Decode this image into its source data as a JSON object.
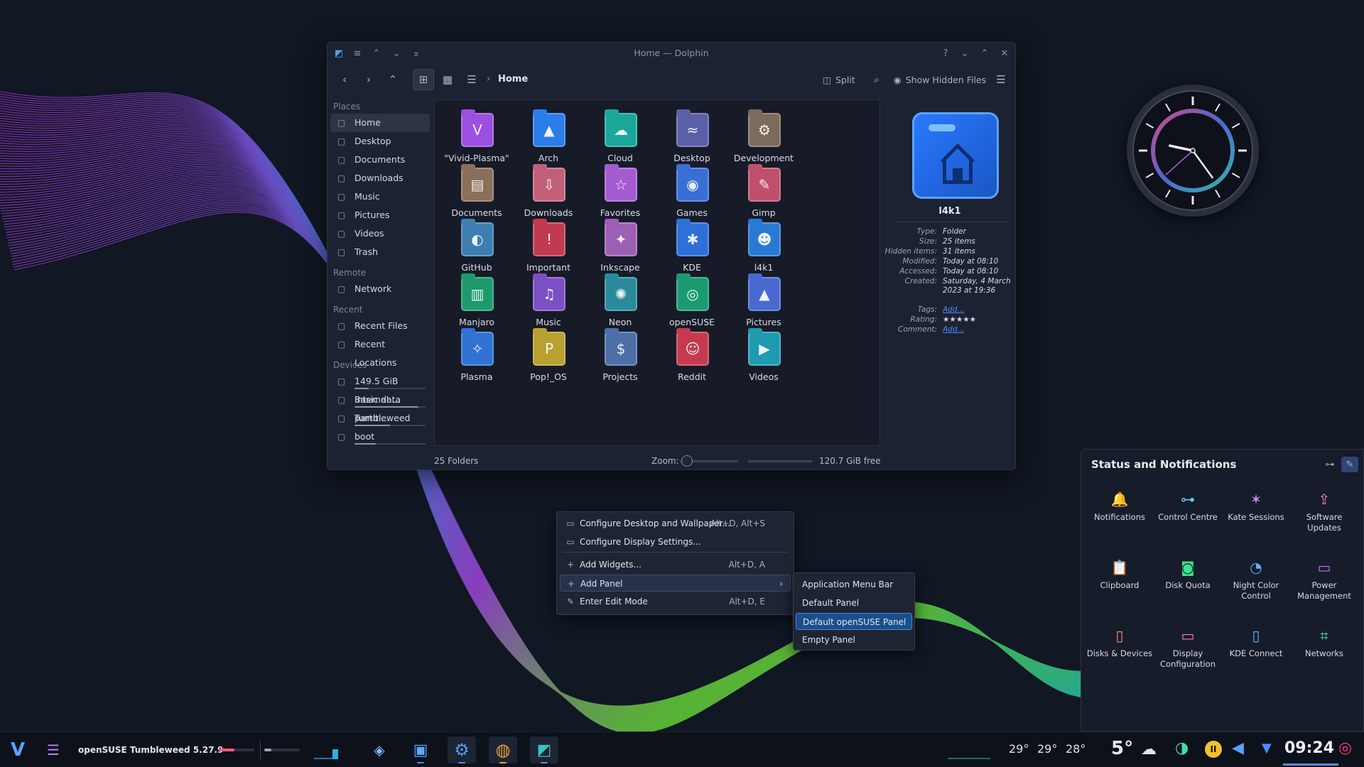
{
  "window": {
    "title": "Home — Dolphin",
    "breadcrumb": "Home",
    "toolbar": {
      "split_label": "Split",
      "show_hidden_label": "Show Hidden Files"
    }
  },
  "places": {
    "sections": [
      {
        "title": "Places",
        "items": [
          {
            "label": "Home",
            "icon": "home-icon",
            "selected": true
          },
          {
            "label": "Desktop",
            "icon": "desktop-icon"
          },
          {
            "label": "Documents",
            "icon": "documents-icon"
          },
          {
            "label": "Downloads",
            "icon": "downloads-icon"
          },
          {
            "label": "Music",
            "icon": "music-icon"
          },
          {
            "label": "Pictures",
            "icon": "pictures-icon"
          },
          {
            "label": "Videos",
            "icon": "videos-icon"
          },
          {
            "label": "Trash",
            "icon": "trash-icon"
          }
        ]
      },
      {
        "title": "Remote",
        "items": [
          {
            "label": "Network",
            "icon": "network-icon"
          }
        ]
      },
      {
        "title": "Recent",
        "items": [
          {
            "label": "Recent Files",
            "icon": "recent-files-icon"
          },
          {
            "label": "Recent Locations",
            "icon": "recent-locations-icon"
          }
        ]
      },
      {
        "title": "Devices",
        "items": [
          {
            "label": "149.5 GiB Internal ...",
            "icon": "drive-icon",
            "usage": 0.2
          },
          {
            "label": "Basic data partiti...",
            "icon": "drive-icon",
            "usage": 0.9
          },
          {
            "label": "Tumbleweed",
            "icon": "drive-icon",
            "usage": 0.5
          },
          {
            "label": "boot",
            "icon": "drive-icon",
            "usage": 0.3
          }
        ]
      }
    ]
  },
  "folders": [
    {
      "name": "\"Vivid-Plasma\"",
      "color": "#9c4fe0",
      "glyph": "V"
    },
    {
      "name": "Arch",
      "color": "#2b7de9",
      "glyph": "▲"
    },
    {
      "name": "Cloud",
      "color": "#1aa79a",
      "glyph": "☁"
    },
    {
      "name": "Desktop",
      "color": "#5b5fa8",
      "glyph": "≈"
    },
    {
      "name": "Development",
      "color": "#7c6a5a",
      "glyph": "⚙"
    },
    {
      "name": "Documents",
      "color": "#8a6f5b",
      "glyph": "▤"
    },
    {
      "name": "Downloads",
      "color": "#c2607a",
      "glyph": "⇩"
    },
    {
      "name": "Favorites",
      "color": "#a45bd0",
      "glyph": "☆"
    },
    {
      "name": "Games",
      "color": "#3a6ed6",
      "glyph": "◉"
    },
    {
      "name": "Gimp",
      "color": "#c0506c",
      "glyph": "✎"
    },
    {
      "name": "GitHub",
      "color": "#3d7fb0",
      "glyph": "◐"
    },
    {
      "name": "Important",
      "color": "#c23a4f",
      "glyph": "!"
    },
    {
      "name": "Inkscape",
      "color": "#9d5fb3",
      "glyph": "✦"
    },
    {
      "name": "KDE",
      "color": "#2f6fd8",
      "glyph": "✱"
    },
    {
      "name": "l4k1",
      "color": "#2a79d4",
      "glyph": "☻"
    },
    {
      "name": "Manjaro",
      "color": "#1d9a6c",
      "glyph": "▥"
    },
    {
      "name": "Music",
      "color": "#7d4fc4",
      "glyph": "♫"
    },
    {
      "name": "Neon",
      "color": "#2a8a9b",
      "glyph": "✺"
    },
    {
      "name": "openSUSE",
      "color": "#1b9a72",
      "glyph": "◎"
    },
    {
      "name": "Pictures",
      "color": "#4a69d0",
      "glyph": "▲"
    },
    {
      "name": "Plasma",
      "color": "#2f72d4",
      "glyph": "✧"
    },
    {
      "name": "Pop!_OS",
      "color": "#b8a12e",
      "glyph": "P"
    },
    {
      "name": "Projects",
      "color": "#4e6eaa",
      "glyph": "$"
    },
    {
      "name": "Reddit",
      "color": "#c63a4f",
      "glyph": "☺"
    },
    {
      "name": "Videos",
      "color": "#1f9ab0",
      "glyph": "▶"
    }
  ],
  "info": {
    "name": "l4k1",
    "rows": [
      {
        "k": "Type:",
        "v": "Folder"
      },
      {
        "k": "Size:",
        "v": "25 items"
      },
      {
        "k": "Hidden items:",
        "v": "31 items"
      },
      {
        "k": "Modified:",
        "v": "Today at 08:10"
      },
      {
        "k": "Accessed:",
        "v": "Today at 08:10"
      },
      {
        "k": "Created:",
        "v": "Saturday, 4 March 2023 at 19:36"
      },
      {
        "k": "Tags:",
        "v": "Add...",
        "link": true
      },
      {
        "k": "Rating:",
        "v": "★★★★★",
        "stars": true
      },
      {
        "k": "Comment:",
        "v": "Add...",
        "link": true
      }
    ],
    "rating": 5
  },
  "statusbar": {
    "count": "25 Folders",
    "zoom_label": "Zoom:",
    "free": "120.7 GiB free"
  },
  "context_menu": {
    "items": [
      {
        "label": "Configure Desktop and Wallpaper...",
        "shortcut": "Alt+D, Alt+S",
        "icon": "wallpaper-icon"
      },
      {
        "label": "Configure Display Settings...",
        "shortcut": "",
        "icon": "display-icon"
      },
      {
        "label": "Add Widgets...",
        "shortcut": "Alt+D, A",
        "icon": "plus-icon"
      },
      {
        "label": "Add Panel",
        "shortcut": "",
        "icon": "plus-icon",
        "submenu": true
      },
      {
        "label": "Enter Edit Mode",
        "shortcut": "Alt+D, E",
        "icon": "edit-icon"
      }
    ],
    "submenu": [
      "Application Menu Bar",
      "Default Panel",
      "Default openSUSE Panel",
      "Empty Panel"
    ]
  },
  "status_notifications": {
    "title": "Status and Notifications",
    "items": [
      {
        "label": "Notifications",
        "icon": "bell-icon",
        "glyph": "🔔",
        "color": "#b58cff"
      },
      {
        "label": "Control Centre",
        "icon": "sliders-icon",
        "glyph": "⊶",
        "color": "#6cc6ff"
      },
      {
        "label": "Kate Sessions",
        "icon": "kate-icon",
        "glyph": "✶",
        "color": "#c48bff"
      },
      {
        "label": "Software Updates",
        "icon": "update-icon",
        "glyph": "⇪",
        "color": "#ff7bd0"
      },
      {
        "label": "Clipboard",
        "icon": "clipboard-icon",
        "glyph": "📋",
        "color": "#f0c030"
      },
      {
        "label": "Disk Quota",
        "icon": "disk-quota-icon",
        "glyph": "◙",
        "color": "#3fe08a"
      },
      {
        "label": "Night Color Control",
        "icon": "night-color-icon",
        "glyph": "◔",
        "color": "#5bb0ff"
      },
      {
        "label": "Power Management",
        "icon": "power-icon",
        "glyph": "▭",
        "color": "#c070ff"
      },
      {
        "label": "Disks & Devices",
        "icon": "disks-icon",
        "glyph": "▯",
        "color": "#ff8b7a"
      },
      {
        "label": "Display Configuration",
        "icon": "monitor-icon",
        "glyph": "▭",
        "color": "#ff79c6"
      },
      {
        "label": "KDE Connect",
        "icon": "phone-icon",
        "glyph": "▯",
        "color": "#62b4ff"
      },
      {
        "label": "Networks",
        "icon": "networks-icon",
        "glyph": "⌗",
        "color": "#3fe0c0"
      }
    ]
  },
  "taskbar": {
    "label": "openSUSE Tumbleweed 5.27.9",
    "temps": [
      "29°",
      "29°",
      "28°"
    ],
    "weather": "5°",
    "time": "09:24"
  },
  "clock": {
    "hours": 9,
    "minutes": 24,
    "seconds": 38
  },
  "colors": {
    "accent": "#4e8cff",
    "highlight": "#1b4f8c",
    "background": "#111723"
  }
}
